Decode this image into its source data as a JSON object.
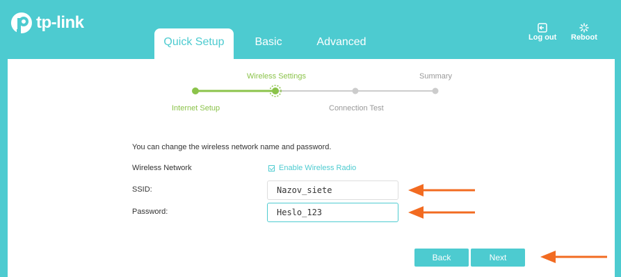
{
  "brand": {
    "logo_text": "tp-link"
  },
  "tabs": [
    {
      "label": "Quick Setup",
      "active": true
    },
    {
      "label": "Basic",
      "active": false
    },
    {
      "label": "Advanced",
      "active": false
    }
  ],
  "header_actions": {
    "logout_label": "Log out",
    "reboot_label": "Reboot"
  },
  "wizard": {
    "steps": [
      {
        "label": "Internet Setup",
        "state": "done"
      },
      {
        "label": "Wireless Settings",
        "state": "current"
      },
      {
        "label": "Connection Test",
        "state": "pending"
      },
      {
        "label": "Summary",
        "state": "pending"
      }
    ]
  },
  "form": {
    "description": "You can change the wireless network name and password.",
    "wireless_network_label": "Wireless Network",
    "enable_radio_label": "Enable Wireless Radio",
    "enable_radio_checked": true,
    "ssid_label": "SSID:",
    "ssid_value": "Nazov_siete",
    "password_label": "Password:",
    "password_value": "Heslo_123"
  },
  "buttons": {
    "back_label": "Back",
    "next_label": "Next"
  },
  "colors": {
    "accent": "#4dcbd0",
    "progress_done": "#8bc34a",
    "annotation_arrow": "#f26b21"
  }
}
